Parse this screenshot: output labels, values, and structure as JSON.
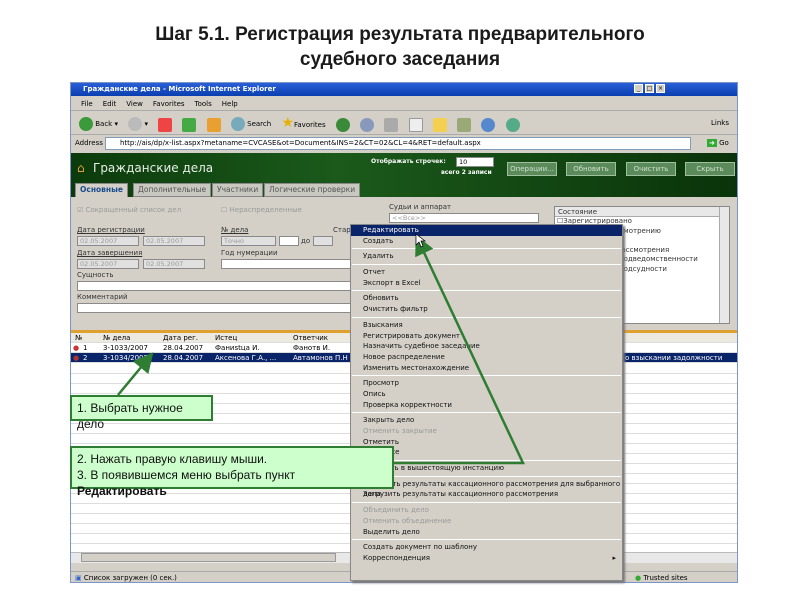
{
  "slide": {
    "title_line1": "Шаг 5.1. Регистрация результата предварительного",
    "title_line2": "судебного заседания"
  },
  "browser": {
    "title": "Гражданские дела - Microsoft Internet Explorer",
    "menu": [
      "File",
      "Edit",
      "View",
      "Favorites",
      "Tools",
      "Help"
    ],
    "toolbar": {
      "back": "Back",
      "search": "Search",
      "favorites": "Favorites",
      "links": "Links"
    },
    "address_label": "Address",
    "url": "http://ais/dp/x-list.aspx?metaname=CVCASE&ot=Document&INS=2&CT=02&CL=4&RET=default.aspx",
    "go": "Go",
    "status": "Список загружен (0 сек.)",
    "zone": "Trusted sites"
  },
  "app": {
    "title": "Гражданские дела",
    "rows_label": "Отображать строчек:",
    "rows_value": "10",
    "total": "всего 2 записи",
    "buttons": [
      "Операции...",
      "Обновить",
      "Очистить",
      "Скрыть"
    ],
    "tabs": [
      "Основные",
      "Дополнительные",
      "Участники",
      "Логические проверки"
    ],
    "filters": {
      "short_list": "Сокращенный список дел",
      "unassigned": "Нераспределенные",
      "reg_date": "Дата регистрации",
      "date1": "02.05.2007",
      "date2": "02.05.2007",
      "case_no": "№ дела",
      "case_mode": "Точно",
      "to": "до",
      "old": "Стар",
      "end_date": "Дата завершения",
      "date3": "02.05.2007",
      "date4": "02.05.2007",
      "year": "Год нумерации",
      "essence": "Сущность",
      "comment": "Комментарий",
      "judges": "Судьи и аппарат",
      "judges_value": "<<Все>>",
      "state": "Состояние",
      "state_items": [
        "Зарегистрировано",
        "рассмотрению",
        "",
        "р",
        "рассмотрения",
        "подведомственности",
        "подсудности"
      ]
    },
    "table": {
      "headers": [
        "№",
        "№ дела",
        "Дата рег.",
        "Истец",
        "Ответчик"
      ],
      "rows": [
        {
          "n": "1",
          "case": "3-1033/2007",
          "date": "28.04.2007",
          "plaintiff": "Фаниstца И.",
          "defendant": "Фанотв И.",
          "essence": ""
        },
        {
          "n": "2",
          "case": "3-1034/2007",
          "date": "28.04.2007",
          "plaintiff": "Аксенова Г.А., ...",
          "defendant": "Автамонов П.Н",
          "essence": "о взыскании задолжности"
        }
      ]
    }
  },
  "context_menu": [
    [
      "Редактировать",
      "Создать"
    ],
    [
      "Удалить"
    ],
    [
      "Отчет",
      "Экспорт в Excel"
    ],
    [
      "Обновить",
      "Очистить фильтр"
    ],
    [
      "Взыскания",
      "Регистрировать документ",
      "Назначить судебное заседание",
      "Новое распределение",
      "Изменить местонахождение"
    ],
    [
      "Просмотр",
      "Опись",
      "Проверка корректности"
    ],
    [
      "Закрыть дело",
      "Отменить закрытие",
      "Отметить",
      "Снять все"
    ],
    [
      "Передать в вышестоящую инстанцию"
    ],
    [
      "Загрузить результаты кассационного рассмотрения для выбранного дела",
      "Загрузить результаты кассационного рассмотрения"
    ],
    [
      "Объединить дело",
      "Отменить объединение",
      "Выделить дело"
    ],
    [
      "Создать документ по шаблону",
      "Корреспонденция"
    ]
  ],
  "callouts": {
    "c1": "1. Выбрать нужное дело",
    "c2_line1": "2. Нажать правую клавишу мыши.",
    "c2_line2_prefix": "3. В появившемся меню выбрать пункт ",
    "c2_line2_bold": "Редактировать"
  },
  "colors": {
    "accent_green": "#2e7d32",
    "callout_bg": "#ccffcc",
    "selection": "#0a246a"
  }
}
